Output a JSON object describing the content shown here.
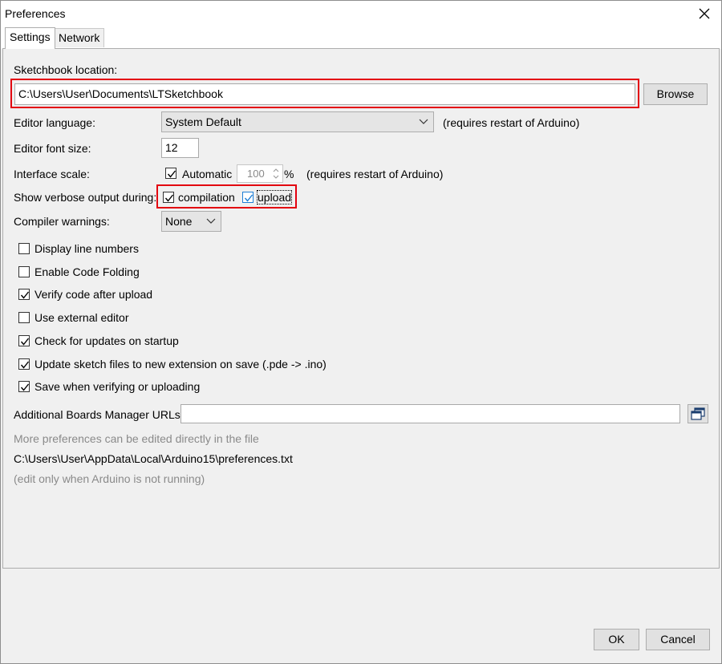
{
  "window": {
    "title": "Preferences"
  },
  "tabs": [
    {
      "label": "Settings"
    },
    {
      "label": "Network"
    }
  ],
  "sketchbook": {
    "label": "Sketchbook location:",
    "value": "C:\\Users\\User\\Documents\\LTSketchbook",
    "browse_label": "Browse"
  },
  "editor_language": {
    "label": "Editor language:",
    "value": "System Default",
    "note": "(requires restart of Arduino)"
  },
  "editor_font_size": {
    "label": "Editor font size:",
    "value": "12"
  },
  "interface_scale": {
    "label": "Interface scale:",
    "automatic_label": "Automatic",
    "automatic_checked": true,
    "scale_value": "100",
    "unit": "%",
    "note": "(requires restart of Arduino)"
  },
  "verbose": {
    "label": "Show verbose output during:",
    "compilation_label": "compilation",
    "compilation_checked": true,
    "upload_label": "upload",
    "upload_checked": true
  },
  "compiler_warnings": {
    "label": "Compiler warnings:",
    "value": "None"
  },
  "options": [
    {
      "label": "Display line numbers",
      "checked": false
    },
    {
      "label": "Enable Code Folding",
      "checked": false
    },
    {
      "label": "Verify code after upload",
      "checked": true
    },
    {
      "label": "Use external editor",
      "checked": false
    },
    {
      "label": "Check for updates on startup",
      "checked": true
    },
    {
      "label": "Update sketch files to new extension on save (.pde -> .ino)",
      "checked": true
    },
    {
      "label": "Save when verifying or uploading",
      "checked": true
    }
  ],
  "boards_manager": {
    "label": "Additional Boards Manager URLs:",
    "value": ""
  },
  "footer_info": {
    "more_text": "More preferences can be edited directly in the file",
    "path": "C:\\Users\\User\\AppData\\Local\\Arduino15\\preferences.txt",
    "note": "(edit only when Arduino is not running)"
  },
  "buttons": {
    "ok": "OK",
    "cancel": "Cancel"
  },
  "colors": {
    "highlight_border": "#e3000f",
    "focus_checkbox": "#1e7fd6"
  },
  "icons": {
    "close": "close-icon",
    "dropdown": "chevron-down-icon",
    "spinner": "spinner-arrows-icon",
    "window_edit": "window-edit-icon",
    "check": "checkmark-icon"
  }
}
